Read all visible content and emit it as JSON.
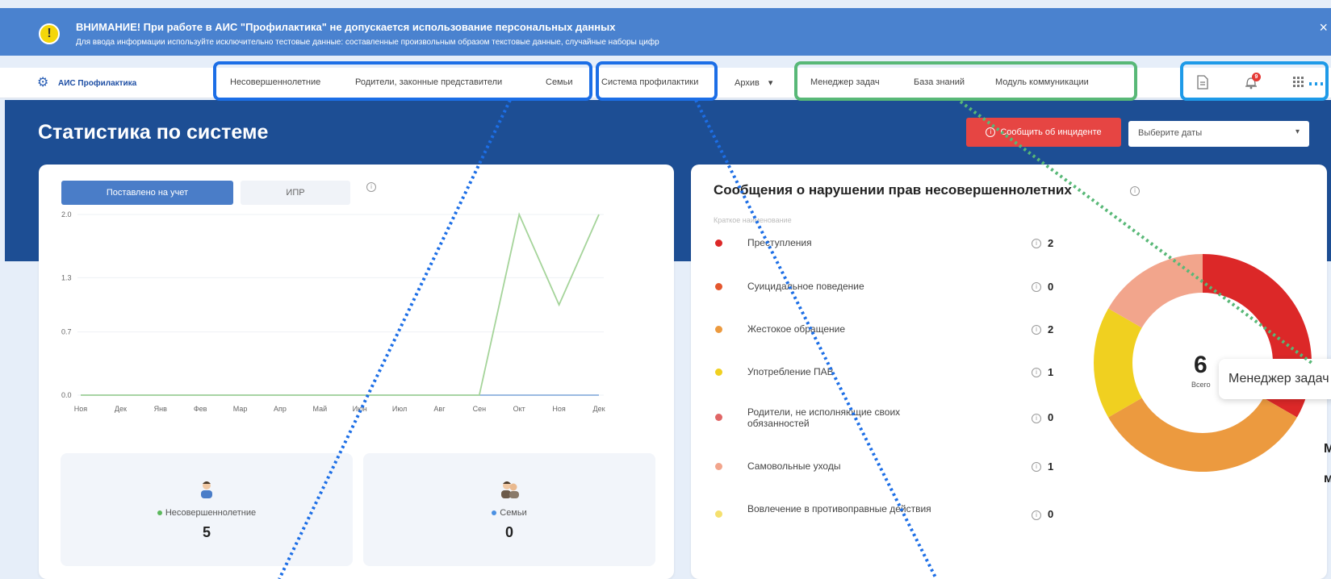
{
  "banner": {
    "title": "ВНИМАНИЕ! При работе в АИС \"Профилактика\" не допускается использование персональных данных",
    "subtitle": "Для ввода информации используйте исключительно тестовые данные: составленные произвольным образом текстовые данные, случайные наборы цифр",
    "warn_glyph": "!",
    "close_glyph": "×",
    "color": "#4a82cf"
  },
  "nav": {
    "logo": "АИС Профилактика",
    "items": [
      "Несовершеннолетние",
      "Родители, законные представители",
      "Семьи",
      "Система профилактики",
      "Архив",
      "Менеджер задач",
      "База знаний",
      "Модуль коммуникации"
    ],
    "archive_chevron": "▾",
    "icons": [
      "document-icon",
      "bell-icon",
      "apps-grid-icon"
    ],
    "bell_badge": "9"
  },
  "header": {
    "title": "Статистика по системе",
    "incident_button": "Сообщить об инциденте",
    "date_placeholder": "Выберите даты",
    "hero_color": "#1d4e94",
    "incident_color": "#e64543"
  },
  "left_card": {
    "tabs": [
      "Поставлено на учет",
      "ИПР"
    ],
    "stats": [
      {
        "label": "Несовершеннолетние",
        "value": "5",
        "dot_color": "#5cb85c"
      },
      {
        "label": "Семьи",
        "value": "0",
        "dot_color": "#4a90e2"
      }
    ]
  },
  "chart_data": [
    {
      "type": "line",
      "x": [
        "Ноя",
        "Дек",
        "Янв",
        "Фев",
        "Мар",
        "Апр",
        "Май",
        "Июн",
        "Июл",
        "Авг",
        "Сен",
        "Окт",
        "Ноя",
        "Дек"
      ],
      "series": [
        {
          "values": [
            0,
            0,
            0,
            0,
            0,
            0,
            0,
            0,
            0,
            0,
            0,
            2,
            1,
            2
          ],
          "color": "#a5d49a"
        }
      ],
      "yticks": [
        "2.0",
        "1.3",
        "0.7",
        "0.0"
      ],
      "ylim": [
        0,
        2
      ],
      "grid": true
    },
    {
      "type": "pie",
      "title": "Сообщения о нарушении прав несовершеннолетних",
      "subtitle": "Краткое наименование",
      "categories": [
        "Преступления",
        "Суицидальное поведение",
        "Жестокое обращение",
        "Употребление ПАВ",
        "Родители, не исполняющие своих обязанностей",
        "Самовольные уходы",
        "Вовлечение в противоправные действия"
      ],
      "values": [
        2,
        0,
        2,
        1,
        0,
        1,
        0
      ],
      "colors": [
        "#dc2828",
        "#e4572e",
        "#ec9a3f",
        "#f0d020",
        "#e06666",
        "#f2a58c",
        "#f5e06e"
      ],
      "total": "6",
      "total_label": "Всего"
    }
  ],
  "tooltip": {
    "text": "Менеджер задач"
  },
  "edge_marks": [
    "М",
    "м"
  ],
  "info_glyph": "i"
}
